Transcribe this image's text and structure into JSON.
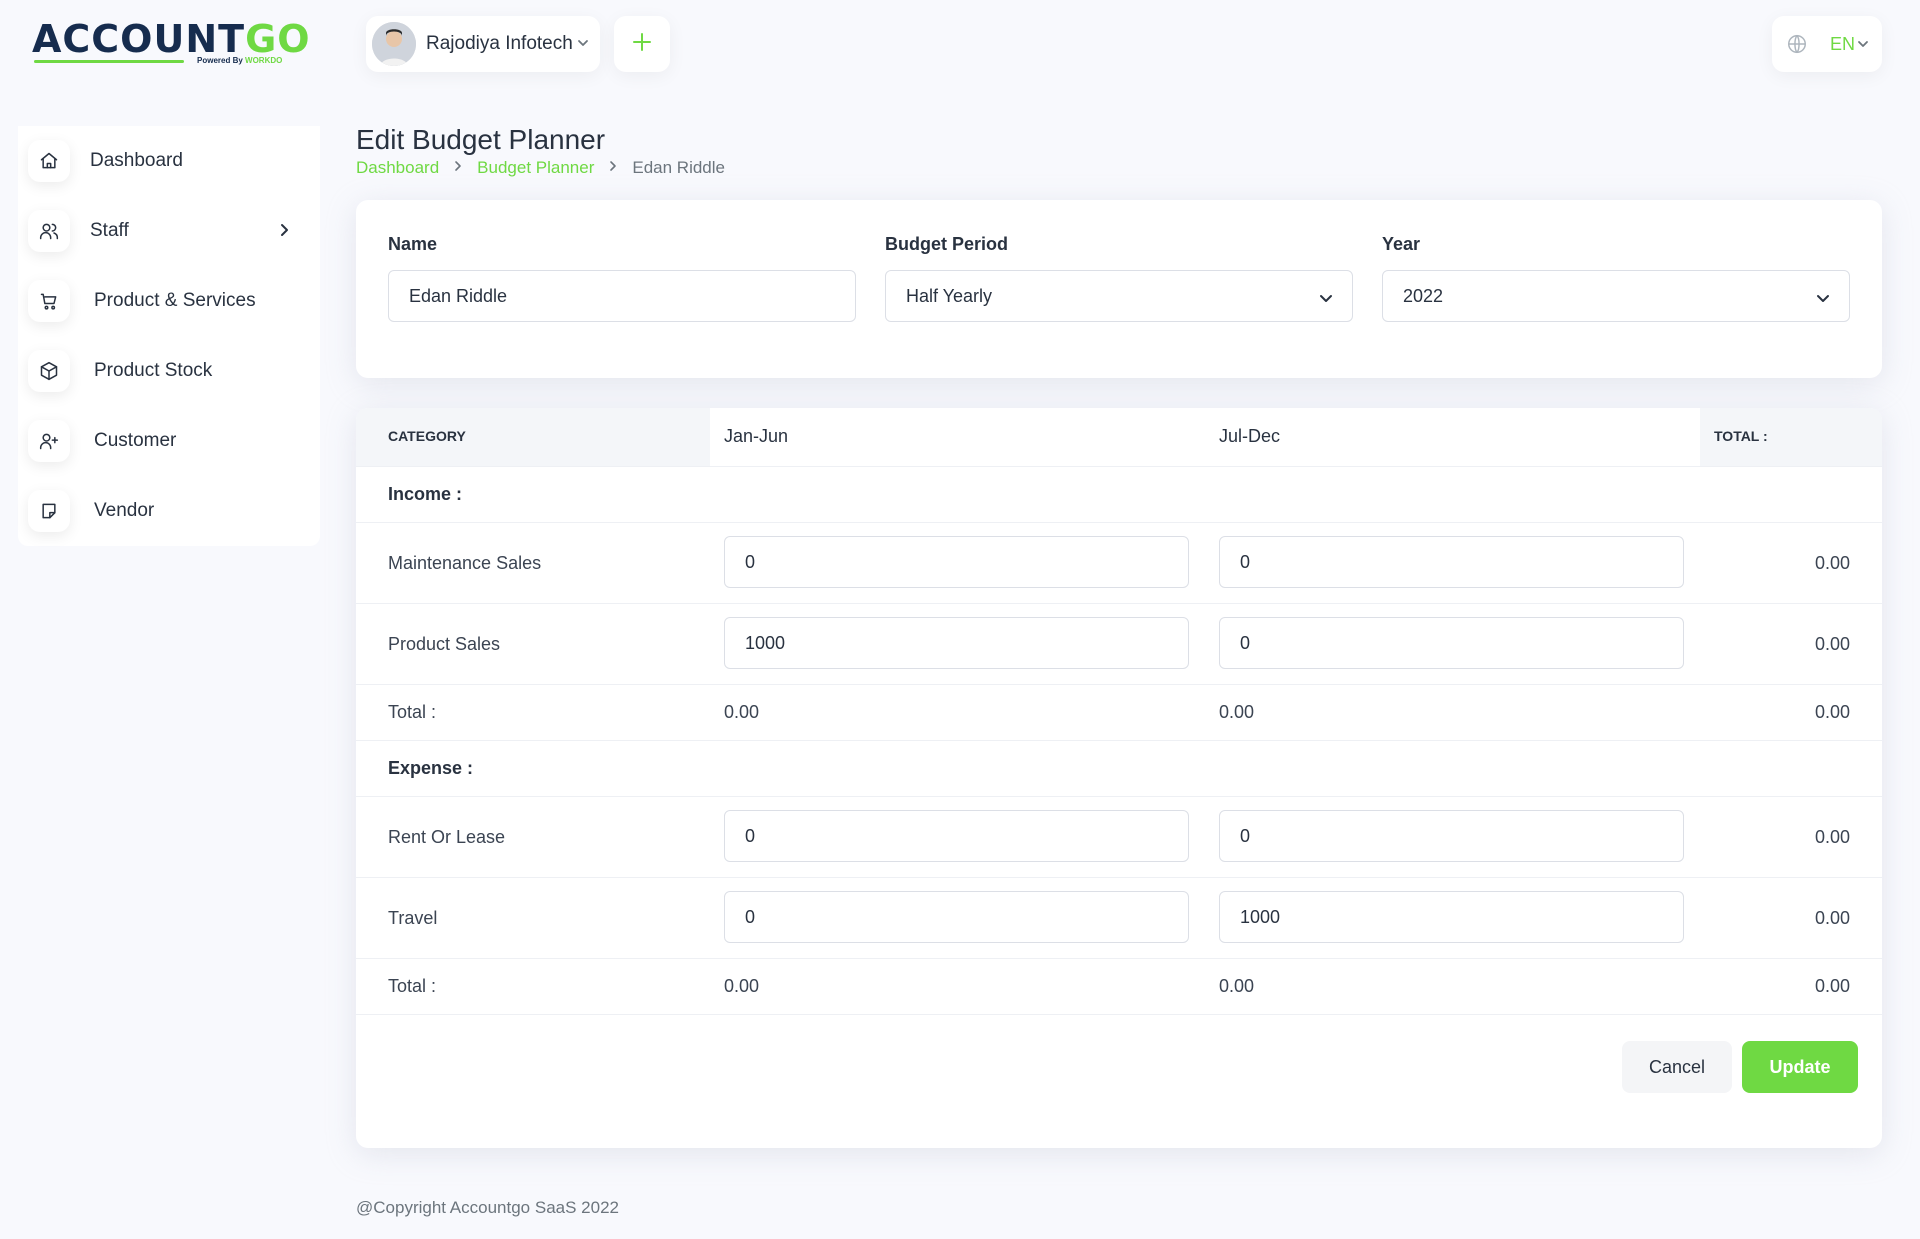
{
  "brand": {
    "logo_main_1": "ACCOUNT",
    "logo_main_2": "GO",
    "logo_sub_1": "Powered By ",
    "logo_sub_2": "WORKDO"
  },
  "sidebar": {
    "items": [
      {
        "label": "Dashboard",
        "icon": "home-icon"
      },
      {
        "label": "Staff",
        "icon": "users-icon"
      },
      {
        "label": "Product & Services",
        "icon": "cart-icon"
      },
      {
        "label": "Product Stock",
        "icon": "box-icon"
      },
      {
        "label": "Customer",
        "icon": "user-plus-icon"
      },
      {
        "label": "Vendor",
        "icon": "note-icon"
      }
    ]
  },
  "header": {
    "company_name": "Rajodiya Infotech",
    "language": "EN"
  },
  "page": {
    "title": "Edit Budget Planner",
    "breadcrumb": [
      "Dashboard",
      "Budget Planner",
      "Edan Riddle"
    ]
  },
  "form": {
    "name_label": "Name",
    "name_value": "Edan Riddle",
    "period_label": "Budget Period",
    "period_value": "Half Yearly",
    "year_label": "Year",
    "year_value": "2022"
  },
  "table": {
    "headers": {
      "category": "CATEGORY",
      "p1": "Jan-Jun",
      "p2": "Jul-Dec",
      "total": "TOTAL :"
    },
    "income": {
      "label": "Income :",
      "rows": [
        {
          "category": "Maintenance Sales",
          "p1": "0",
          "p2": "0",
          "total": "0.00"
        },
        {
          "category": "Product Sales",
          "p1": "1000",
          "p2": "0",
          "total": "0.00"
        }
      ],
      "total": {
        "label": "Total :",
        "p1": "0.00",
        "p2": "0.00",
        "total": "0.00"
      }
    },
    "expense": {
      "label": "Expense :",
      "rows": [
        {
          "category": "Rent Or Lease",
          "p1": "0",
          "p2": "0",
          "total": "0.00"
        },
        {
          "category": "Travel",
          "p1": "0",
          "p2": "1000",
          "total": "0.00"
        }
      ],
      "total": {
        "label": "Total :",
        "p1": "0.00",
        "p2": "0.00",
        "total": "0.00"
      }
    }
  },
  "actions": {
    "cancel": "Cancel",
    "update": "Update"
  },
  "footer": {
    "copyright": "@Copyright Accountgo SaaS 2022"
  },
  "colors": {
    "accent": "#6fd943",
    "text": "#293240",
    "background": "#f8f9fd"
  }
}
